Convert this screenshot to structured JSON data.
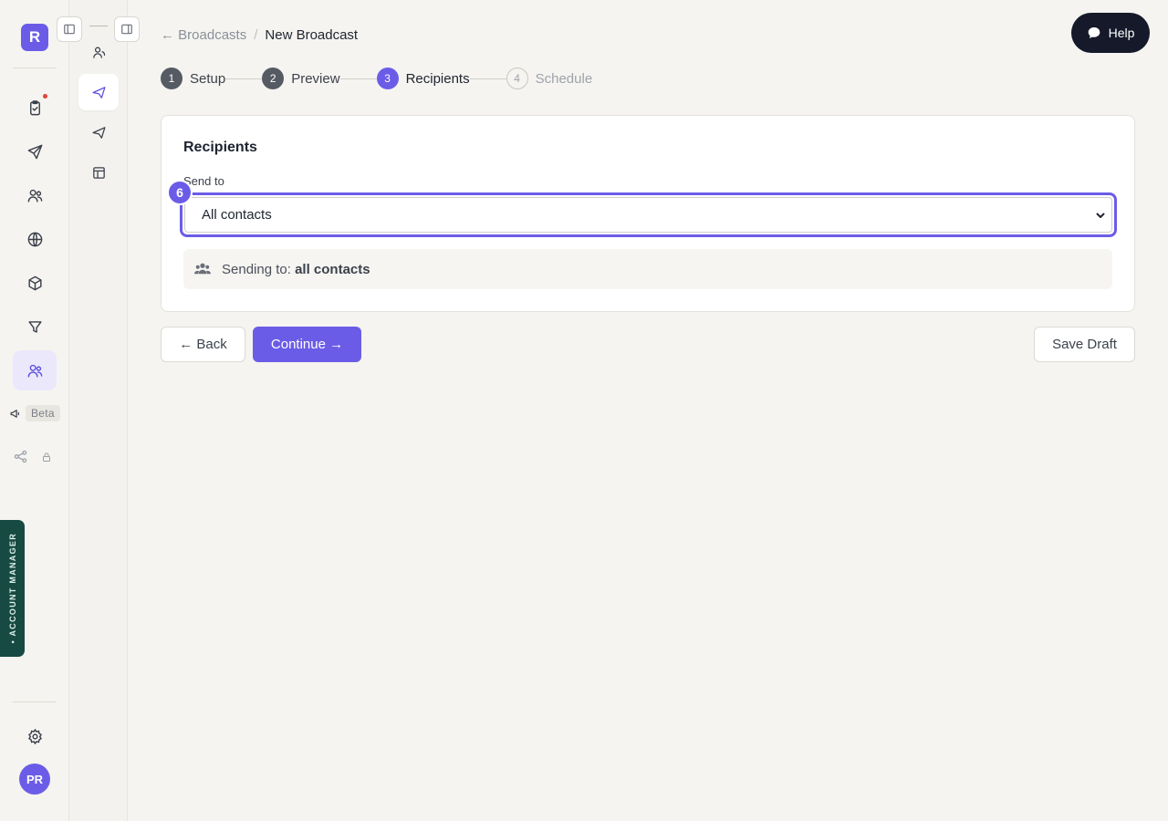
{
  "rail": {
    "logo": "R",
    "beta": "Beta",
    "account_manager": "• ACCOUNT MANAGER",
    "avatar": "PR"
  },
  "breadcrumb": {
    "back": "← Broadcasts",
    "separator": "/",
    "current": "New Broadcast"
  },
  "help": {
    "label": "Help"
  },
  "steps": [
    {
      "num": "1",
      "label": "Setup"
    },
    {
      "num": "2",
      "label": "Preview"
    },
    {
      "num": "3",
      "label": "Recipients"
    },
    {
      "num": "4",
      "label": "Schedule"
    }
  ],
  "recipients": {
    "title": "Recipients",
    "send_to_label": "Send to",
    "send_to_value": "All contacts",
    "marker": "6",
    "sending_prefix": "Sending to:",
    "sending_value": "all contacts"
  },
  "actions": {
    "back": "← Back",
    "continue": "Continue →",
    "save_draft": "Save Draft"
  },
  "colors": {
    "accent": "#6b5ce7",
    "help_bg": "#15192a",
    "account_manager_bg": "#174a43"
  }
}
